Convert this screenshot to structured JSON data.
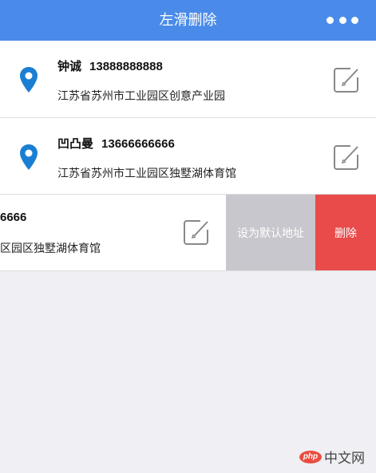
{
  "header": {
    "title": "左滑删除",
    "more_icon": "more-dots-icon"
  },
  "addresses": [
    {
      "name": "钟诚",
      "phone": "13888888888",
      "address": "江苏省苏州市工业园区创意产业园"
    },
    {
      "name": "凹凸曼",
      "phone": "13666666666",
      "address": "江苏省苏州市工业园区独墅湖体育馆"
    },
    {
      "visible_phone": "6666",
      "visible_address": "区园区独墅湖体育馆"
    }
  ],
  "actions": {
    "set_default": "设为默认地址",
    "delete": "删除"
  },
  "watermark": {
    "logo_text": "php",
    "text": "中文网"
  },
  "colors": {
    "header": "#4a8bea",
    "pin": "#1a7fd2",
    "delete": "#e94a4a",
    "set_default": "#c8c7cd",
    "background": "#efeff4"
  }
}
